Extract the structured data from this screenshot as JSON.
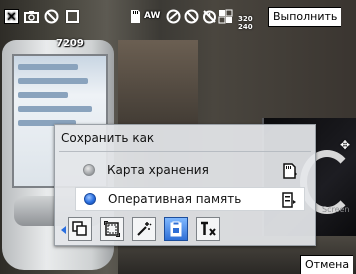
{
  "status_bar": {
    "close_icon": "close-x-icon",
    "camera_icon": "camera-icon",
    "icons": [
      "no-flash-icon",
      "stop-icon",
      "memory-card-icon",
      "auto-white-balance-icon",
      "night-mode-icon",
      "no-effect-icon",
      "no-timer-icon",
      "resolution-icon"
    ],
    "resolution_top": "320",
    "resolution_bottom": "240",
    "shots_remaining": "7209",
    "execute_label": "Выполнить"
  },
  "dialog": {
    "title": "Сохранить как",
    "options": [
      {
        "label": "Карта хранения",
        "selected": false,
        "icon": "memory-card-icon"
      },
      {
        "label": "Оперативная память",
        "selected": true,
        "icon": "internal-memory-icon"
      }
    ],
    "toolbar": [
      "copy-tool",
      "frame-tool",
      "flash-tool",
      "save-location-tool",
      "settings-tool"
    ],
    "active_tool_index": 3
  },
  "softkeys": {
    "cancel_label": "Отмена"
  },
  "colors": {
    "accent": "#2a6fe0",
    "dialog_bg": "#e4e6e9"
  }
}
